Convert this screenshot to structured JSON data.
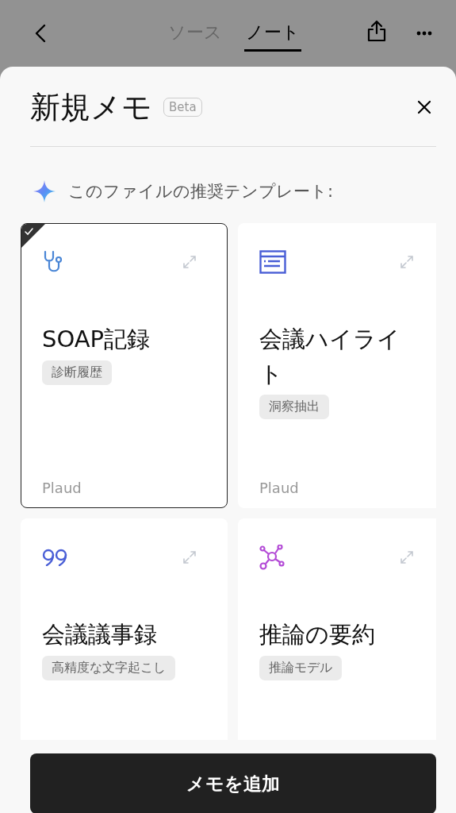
{
  "nav": {
    "tabs": [
      {
        "label": "ソース",
        "selected": false
      },
      {
        "label": "ノート",
        "selected": true
      }
    ]
  },
  "sheet": {
    "title": "新規メモ",
    "badge": "Beta",
    "subtitle": "このファイルの推奨テンプレート:"
  },
  "templates": [
    {
      "kind": "stethoscope",
      "title": "SOAP記録",
      "tag": "診断履歴",
      "source": "Plaud",
      "selected": true
    },
    {
      "kind": "document",
      "title": "会議ハイライト",
      "tag": "洞察抽出",
      "source": "Plaud",
      "selected": false
    },
    {
      "kind": "quote",
      "title": "会議議事録",
      "tag": "高精度な文字起こし",
      "selected": false
    },
    {
      "kind": "network",
      "title": "推論の要約",
      "tag": "推論モデル",
      "selected": false
    }
  ],
  "action": {
    "label": "メモを追加"
  }
}
